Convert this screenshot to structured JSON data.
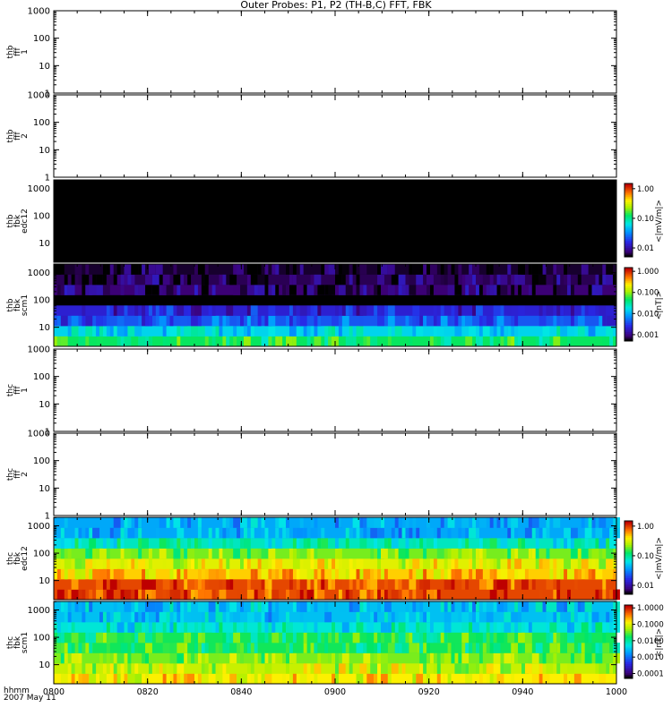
{
  "chart_data": {
    "type": "heatmap",
    "title": "Outer Probes: P1, P2 (TH-B,C) FFT, FBK",
    "xlabel": "hhmm",
    "date_label": "2007 May 11",
    "x_range": [
      "0800",
      "1000"
    ],
    "x_ticks": [
      "0800",
      "0820",
      "0840",
      "0900",
      "0920",
      "0940",
      "1000"
    ],
    "panels": [
      {
        "ylabel": [
          "thb",
          "fff",
          "1"
        ],
        "yscale": "log",
        "ylim": [
          1,
          1000
        ],
        "yticks": [
          "1000",
          "100",
          "10",
          "1"
        ],
        "data": "none"
      },
      {
        "ylabel": [
          "thb",
          "fff",
          "2"
        ],
        "yscale": "log",
        "ylim": [
          1,
          1000
        ],
        "yticks": [
          "1000",
          "100",
          "10",
          "1"
        ],
        "data": "none"
      },
      {
        "ylabel": [
          "thb",
          "fbk",
          "edc12"
        ],
        "yscale": "log",
        "ylim": [
          2,
          2048
        ],
        "yticks": [
          "1000",
          "100",
          "10"
        ],
        "colorbar_label": "<|mV/m|>",
        "colorbar_ticks": [
          "1.00",
          "0.10",
          "0.01"
        ],
        "colorbar_range": [
          0.005,
          1.5
        ],
        "bands_low_to_high": [
          0.0,
          0.0,
          0.0,
          0.0,
          0.0,
          0.0,
          0.005,
          0.005
        ]
      },
      {
        "ylabel": [
          "thb",
          "fbk",
          "scm1"
        ],
        "yscale": "log",
        "ylim": [
          2,
          2048
        ],
        "yticks": [
          "1000",
          "100",
          "10"
        ],
        "colorbar_label": "<|nT|>",
        "colorbar_ticks": [
          "1.000",
          "0.100",
          "0.010",
          "0.001"
        ],
        "colorbar_range": [
          0.0005,
          1.5
        ],
        "bands_low_to_high": [
          0.05,
          0.015,
          0.004,
          0.002,
          0.0,
          0.0008,
          0.0007,
          0.0006
        ]
      },
      {
        "ylabel": [
          "thc",
          "fff",
          "1"
        ],
        "yscale": "log",
        "ylim": [
          1,
          1000
        ],
        "yticks": [
          "1000",
          "100",
          "10",
          "1"
        ],
        "data": "none"
      },
      {
        "ylabel": [
          "thc",
          "fff",
          "2"
        ],
        "yscale": "log",
        "ylim": [
          1,
          1000
        ],
        "yticks": [
          "1000",
          "100",
          "10",
          "1"
        ],
        "data": "none"
      },
      {
        "ylabel": [
          "thc",
          "fbk",
          "edc12"
        ],
        "yscale": "log",
        "ylim": [
          2,
          2048
        ],
        "yticks": [
          "1000",
          "100",
          "10"
        ],
        "colorbar_label": "<|mV/m|>",
        "colorbar_ticks": [
          "1.00",
          "0.10",
          "0.01"
        ],
        "colorbar_range": [
          0.005,
          1.5
        ],
        "bands_low_to_high": [
          1.0,
          1.0,
          0.5,
          0.35,
          0.2,
          0.08,
          0.04,
          0.04
        ]
      },
      {
        "ylabel": [
          "thc",
          "fbk",
          "scm1"
        ],
        "yscale": "log",
        "ylim": [
          2,
          2048
        ],
        "yticks": [
          "1000",
          "100",
          "10"
        ],
        "colorbar_label": "<|nT|>",
        "colorbar_ticks": [
          "1.0000",
          "0.1000",
          "0.0100",
          "0.0010",
          "0.0001"
        ],
        "colorbar_range": [
          5e-05,
          1.5
        ],
        "bands_low_to_high": [
          0.15,
          0.08,
          0.04,
          0.02,
          0.02,
          0.006,
          0.003,
          0.003
        ]
      }
    ]
  }
}
